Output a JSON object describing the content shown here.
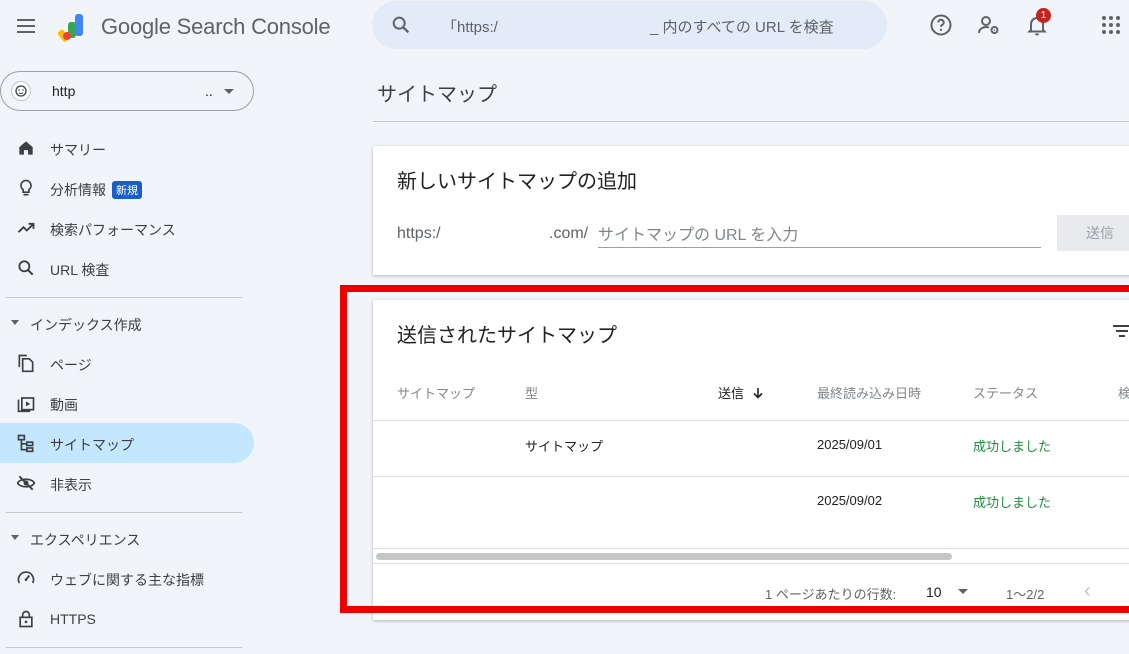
{
  "header": {
    "app_title": "Google Search Console",
    "search_query_start": "「https:/",
    "search_query_end": "_ 内のすべての URL を検査",
    "notification_count": "1"
  },
  "property": {
    "label": "http",
    "ellipsis": ".."
  },
  "sidebar": {
    "items": [
      {
        "label": "サマリー",
        "icon": "home-icon"
      },
      {
        "label": "分析情報",
        "badge": "新規",
        "icon": "lightbulb-icon"
      },
      {
        "label": "検索パフォーマンス",
        "icon": "trending-up-icon"
      },
      {
        "label": "URL 検査",
        "icon": "search-icon"
      }
    ],
    "sections": [
      {
        "heading": "インデックス作成",
        "items": [
          {
            "label": "ページ",
            "icon": "pages-icon"
          },
          {
            "label": "動画",
            "icon": "video-icon"
          },
          {
            "label": "サイトマップ",
            "icon": "sitemap-icon",
            "active": true
          },
          {
            "label": "非表示",
            "icon": "visibility-off-icon"
          }
        ]
      },
      {
        "heading": "エクスペリエンス",
        "items": [
          {
            "label": "ウェブに関する主な指標",
            "icon": "speed-icon"
          },
          {
            "label": "HTTPS",
            "icon": "lock-icon"
          }
        ]
      }
    ]
  },
  "main": {
    "page_title": "サイトマップ",
    "add_card": {
      "title": "新しいサイトマップの追加",
      "url_prefix": "https:/",
      "url_suffix": ".com/",
      "input_placeholder": "サイトマップの URL を入力",
      "submit_label": "送信"
    },
    "submitted_card": {
      "title": "送信されたサイトマップ",
      "columns": [
        "サイトマップ",
        "型",
        "送信",
        "最終読み込み日時",
        "ステータス",
        "検"
      ],
      "rows": [
        {
          "sitemap": "",
          "type": "サイトマップ",
          "submitted": "",
          "last_read": "2025/09/01",
          "status": "成功しました"
        },
        {
          "sitemap": "",
          "type": "",
          "submitted": "",
          "last_read": "2025/09/02",
          "status": "成功しました"
        }
      ],
      "pagination": {
        "rows_per_page_label": "1 ページあたりの行数:",
        "rows_per_page": "10",
        "range": "1〜2/2"
      }
    }
  },
  "colors": {
    "accent_active": "#c2e7ff",
    "success": "#1e8e3e",
    "highlight": "#ee0000",
    "search_bg": "#e3eaf8"
  }
}
